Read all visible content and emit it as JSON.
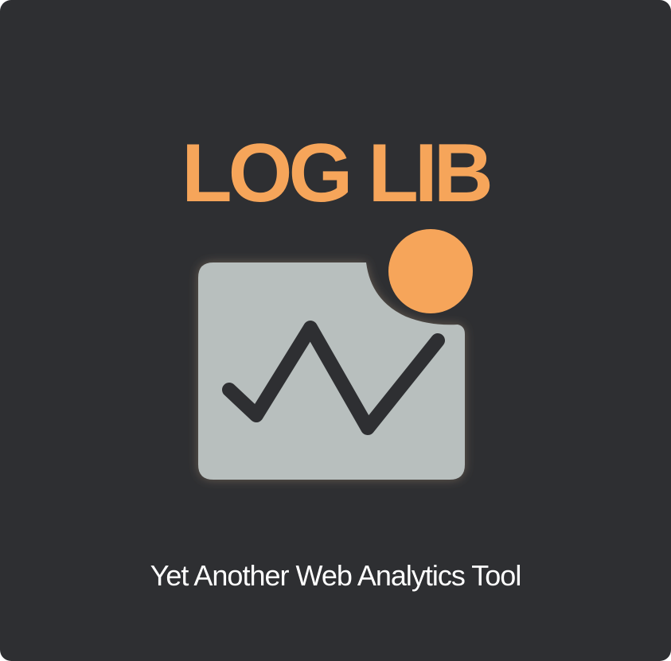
{
  "brand": {
    "name": "LOG LIB",
    "tagline": "Yet Another Web Analytics Tool"
  },
  "logo": {
    "icon": "analytics-chart-icon",
    "colors": {
      "background": "#2e2f32",
      "accent": "#f6a55a",
      "panel": "#b8bfbe",
      "line": "#2e2f32"
    }
  }
}
